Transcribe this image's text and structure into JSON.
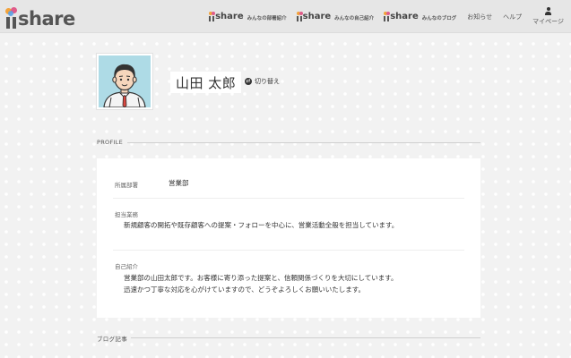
{
  "header": {
    "logo_text": "share",
    "nav": [
      {
        "brand": "share",
        "label": "みんなの部署紹介"
      },
      {
        "brand": "share",
        "label": "みんなの自己紹介"
      },
      {
        "brand": "share",
        "label": "みんなのブログ"
      }
    ],
    "links": {
      "news": "お知らせ",
      "help": "ヘルプ",
      "mypage": "マイページ"
    }
  },
  "profile": {
    "name": "山田 太郎",
    "switch_label": "切り替え"
  },
  "sections": {
    "profile_title": "PROFILE",
    "blog_title": "ブログ記事"
  },
  "details": {
    "department_label": "所属部署",
    "department_value": "営業部",
    "duty_label": "担当業務",
    "duty_value": "新規顧客の開拓や既存顧客への提案・フォローを中心に、営業活動全般を担当しています。",
    "intro_label": "自己紹介",
    "intro_line1": "営業部の山田太郎です。お客様に寄り添った提案と、信頼関係づくりを大切にしています。",
    "intro_line2": "迅速かつ丁寧な対応を心がけていますので、どうぞよろしくお願いいたします。"
  },
  "colors": {
    "header_bg": "#e6e6e6",
    "page_bg": "#f2f2f2",
    "avatar_bg": "#aedbe6",
    "tie": "#d9473f"
  }
}
